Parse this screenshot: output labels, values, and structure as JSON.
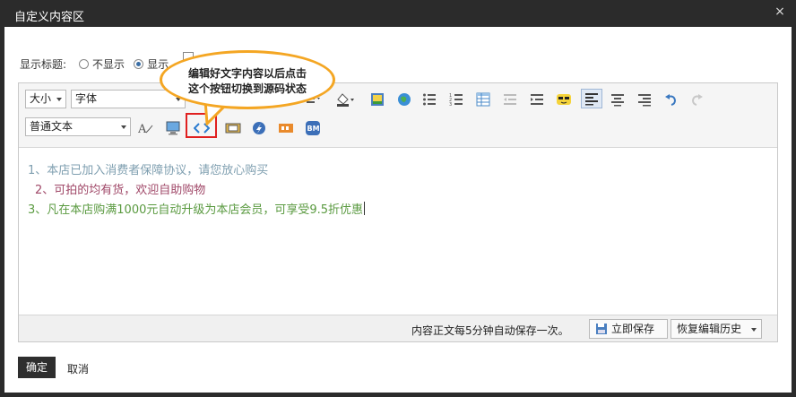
{
  "dialog": {
    "title": "自定义内容区",
    "close_glyph": "×"
  },
  "display_title": {
    "label": "显示标题:",
    "options": [
      {
        "label": "不显示",
        "selected": false
      },
      {
        "label": "显示",
        "selected": true
      }
    ]
  },
  "toolbar": {
    "size_select": "大小",
    "font_select": "字体",
    "format_select": "普通文本"
  },
  "callout": {
    "line1": "编辑好文字内容以后点击",
    "line2": "这个按钮切换到源码状态"
  },
  "content": {
    "lines": [
      "1、本店已加入消费者保障协议，请您放心购买",
      "2、可拍的均有货，欢迎自助购物",
      "3、凡在本店购满1000元自动升级为本店会员，可享受9.5折优惠"
    ]
  },
  "statusbar": {
    "autosave_note": "内容正文每5分钟自动保存一次。",
    "save_now": "立即保存",
    "restore_history": "恢复编辑历史"
  },
  "footer": {
    "confirm": "确定",
    "cancel": "取消"
  },
  "icons": [
    "font-color-icon",
    "fill-color-icon",
    "image-icon",
    "globe-icon",
    "bullet-list-icon",
    "numbered-list-icon",
    "table-icon",
    "outdent-icon",
    "indent-icon",
    "emoticon-icon",
    "align-left-icon",
    "align-center-icon",
    "align-right-icon",
    "undo-icon",
    "redo-icon",
    "clear-format-icon",
    "monitor-icon",
    "source-code-icon",
    "media-icon",
    "flash-icon",
    "film-icon",
    "bm-icon"
  ],
  "colors": {
    "accent_border": "#e02020",
    "callout_border": "#f4a623",
    "line1": "#7f9fb0",
    "line2": "#a04868",
    "line3": "#5a9a40"
  }
}
